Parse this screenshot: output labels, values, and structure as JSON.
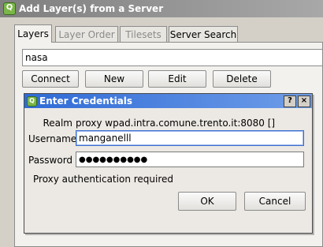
{
  "window": {
    "title": "Add Layer(s) from a Server",
    "app_icon": "Q"
  },
  "tabs": [
    {
      "label": "Layers",
      "active": true
    },
    {
      "label": "Layer Order",
      "active": false
    },
    {
      "label": "Tilesets",
      "active": false
    },
    {
      "label": "Server Search",
      "active": false
    }
  ],
  "connection": {
    "selected": "nasa"
  },
  "connection_buttons": {
    "connect": "Connect",
    "new": "New",
    "edit": "Edit",
    "delete": "Delete"
  },
  "dialog": {
    "title": "Enter Credentials",
    "help_glyph": "?",
    "close_glyph": "×",
    "realm_label": "Realm",
    "realm_value": "proxy wpad.intra.comune.trento.it:8080 []",
    "username_label": "Username",
    "username_value": "manganelll",
    "password_label": "Password",
    "password_value": "●●●●●●●●●●",
    "message": "Proxy authentication required",
    "ok": "OK",
    "cancel": "Cancel"
  },
  "colors": {
    "dialog_titlebar": "#2f6bd6",
    "main_titlebar": "#7f7f7f",
    "focus_border": "#3c6fd0"
  }
}
